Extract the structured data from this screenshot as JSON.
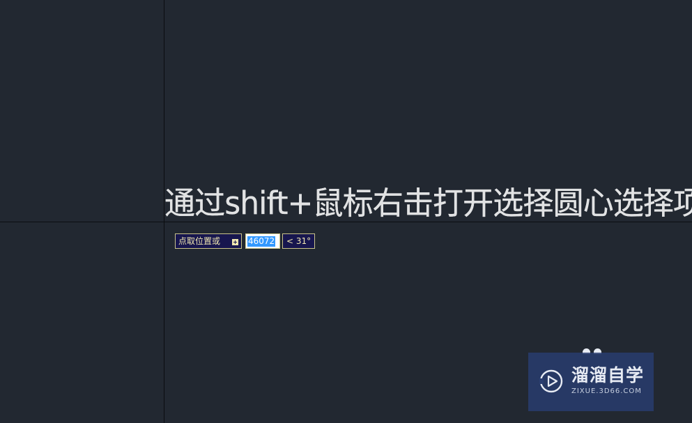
{
  "drawing": {
    "annotation_text": "通过shift+鼠标右击打开选择圆心选择项"
  },
  "dynamic_input": {
    "prompt_label": "点取位置或",
    "expand_icon": "plus-square-icon",
    "distance_value": "46072",
    "angle_value": "< 31°"
  },
  "watermark": {
    "brand": "溜溜自学",
    "url": "ZIXUE.3D66.COM",
    "logo_icon": "play-circle-icon"
  },
  "colors": {
    "background": "#222831",
    "crosshair": "#0b0d10",
    "prompt_bg": "#17164e",
    "prompt_border": "#c9c38a",
    "prompt_text": "#f0e7b0",
    "selection": "#3399ff"
  }
}
